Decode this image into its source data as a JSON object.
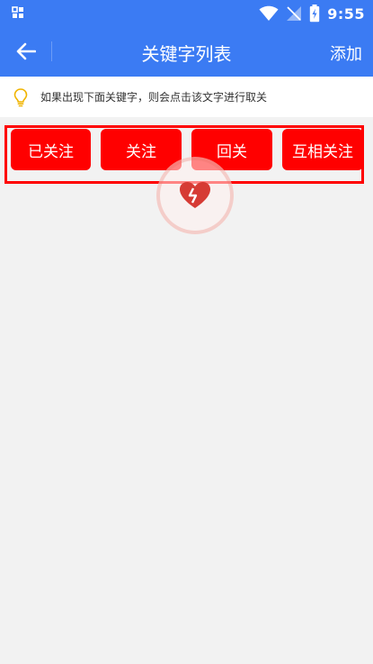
{
  "status_bar": {
    "time": "9:55",
    "icons": [
      "notification-grid-icon",
      "wifi-icon",
      "signal-off-icon",
      "battery-charging-icon"
    ]
  },
  "app_bar": {
    "back_icon": "arrow-left-icon",
    "title": "关键字列表",
    "add_label": "添加"
  },
  "tip": {
    "icon": "lightbulb-icon",
    "text": "如果出现下面关键字，则会点击该文字进行取关"
  },
  "keywords": [
    {
      "label": "已关注"
    },
    {
      "label": "关注"
    },
    {
      "label": "回关"
    },
    {
      "label": "互相关注"
    }
  ],
  "loading": {
    "icon": "heart-loading-icon"
  },
  "colors": {
    "primary": "#3b7bf3",
    "keyword_button": "#ff0000",
    "background": "#f2f2f2"
  }
}
